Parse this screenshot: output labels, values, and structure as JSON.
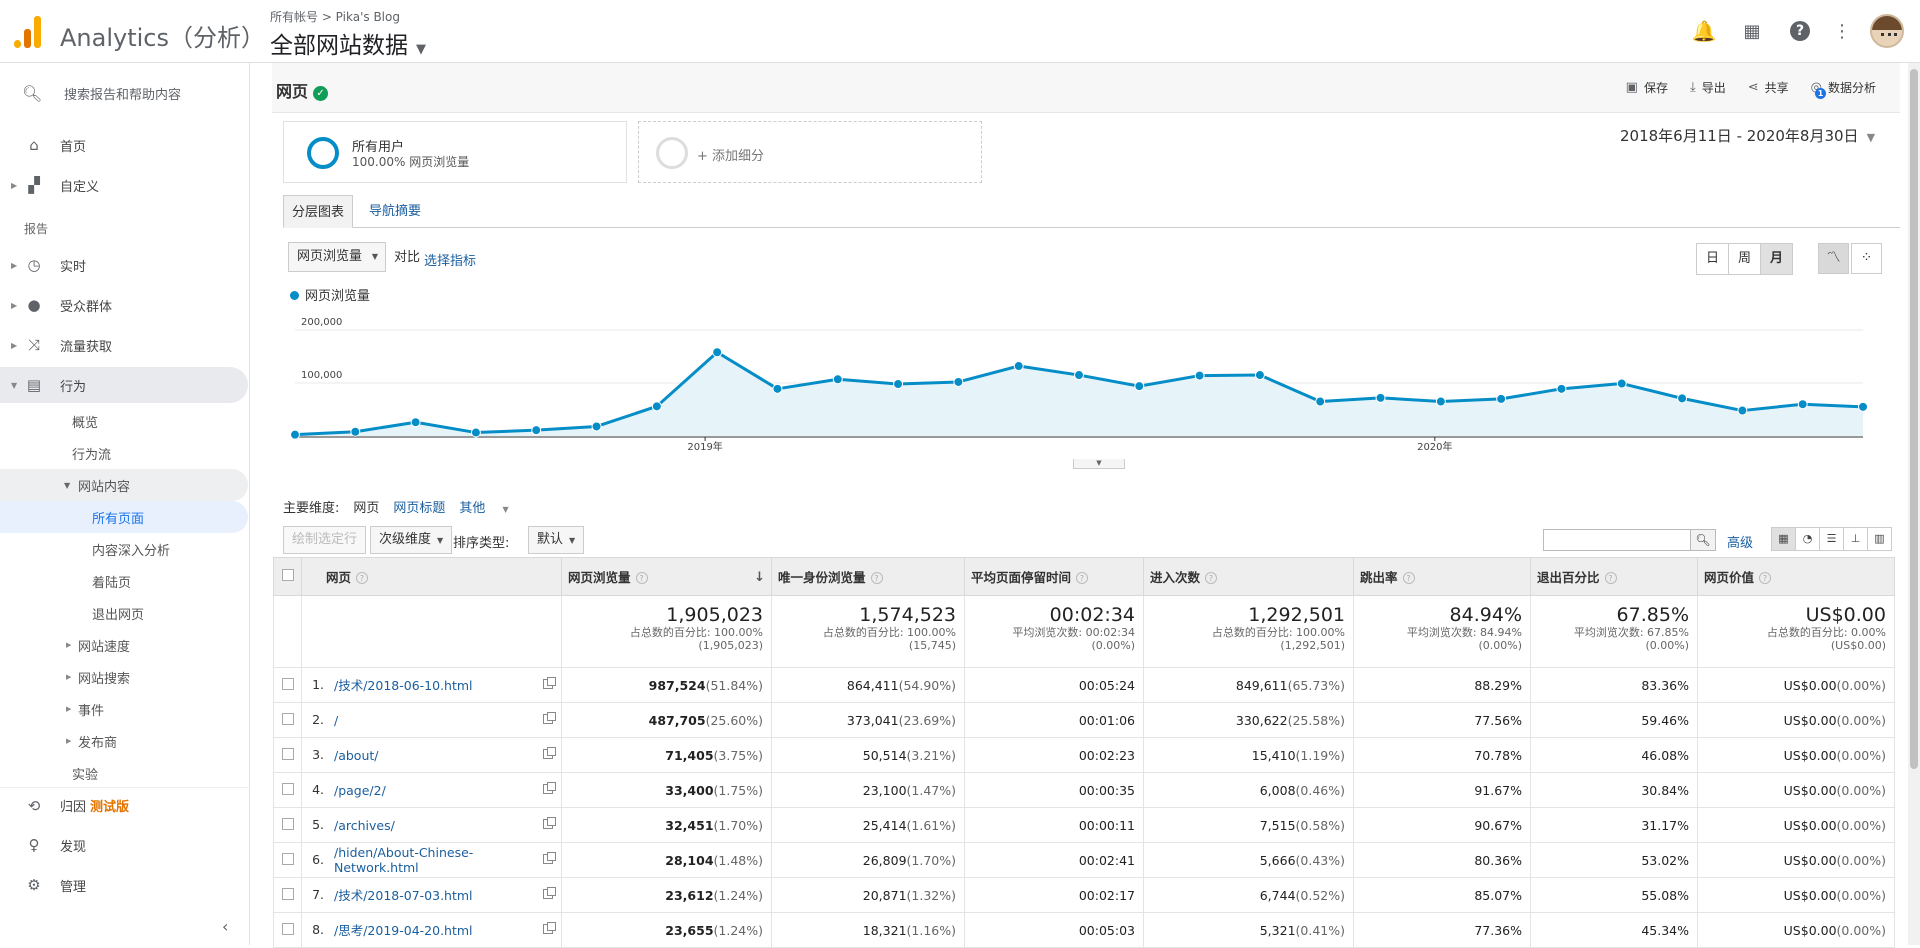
{
  "app": {
    "title": "Analytics（分析）",
    "account_path": "所有帐号 > Pika's Blog",
    "property": "全部网站数据"
  },
  "sidebar": {
    "search_placeholder": "搜索报告和帮助内容",
    "home": "首页",
    "customize": "自定义",
    "reports_heading": "报告",
    "realtime": "实时",
    "audience": "受众群体",
    "acquisition": "流量获取",
    "behavior": "行为",
    "behavior_sub": {
      "overview": "概览",
      "flow": "行为流",
      "site_content": "网站内容",
      "all_pages": "所有页面",
      "drilldown": "内容深入分析",
      "landing": "着陆页",
      "exit": "退出网页",
      "speed": "网站速度",
      "search": "网站搜索",
      "events": "事件",
      "publisher": "发布商",
      "experiments": "实验"
    },
    "attribution": "归因",
    "attribution_badge": "测试版",
    "discover": "发现",
    "admin": "管理"
  },
  "header": {
    "page_title": "网页",
    "save": "保存",
    "export": "导出",
    "share": "共享",
    "insights": "数据分析",
    "insights_badge": "1"
  },
  "segments": {
    "all_users": "所有用户",
    "all_users_sub": "100.00% 网页浏览量",
    "add_segment": "+ 添加细分"
  },
  "date_range": "2018年6月11日 - 2020年8月30日",
  "tabs": {
    "explorer": "分层图表",
    "nav_summary": "导航摘要"
  },
  "chart_controls": {
    "metric": "网页浏览量",
    "vs": "对比",
    "pick_metric": "选择指标",
    "day": "日",
    "week": "周",
    "month": "月"
  },
  "chart_data": {
    "type": "area",
    "series": [
      {
        "name": "网页浏览量",
        "color": "#058dc7",
        "values": [
          2500,
          8000,
          26000,
          6500,
          11000,
          18000,
          56000,
          158000,
          89000,
          107000,
          98000,
          102000,
          132000,
          115000,
          94000,
          114000,
          115000,
          65000,
          72000,
          65000,
          70000,
          89000,
          99000,
          71000,
          48000,
          60000,
          55000
        ]
      }
    ],
    "x_tick_labels": [
      "2019年",
      "2020年"
    ],
    "y_tick_labels": [
      "200,000",
      "100,000"
    ],
    "ylim": [
      0,
      200000
    ],
    "grid": true
  },
  "dimensions": {
    "label": "主要维度:",
    "current": "网页",
    "page_title": "网页标题",
    "other": "其他"
  },
  "toolbar": {
    "plot_rows": "绘制选定行",
    "secondary": "次级维度",
    "sort_label": "排序类型:",
    "sort_value": "默认",
    "advanced": "高级"
  },
  "table": {
    "headers": [
      "网页",
      "网页浏览量",
      "唯一身份浏览量",
      "平均页面停留时间",
      "进入次数",
      "跳出率",
      "退出百分比",
      "网页价值"
    ],
    "totals": [
      {
        "big": "1,905,023",
        "sub1": "占总数的百分比: 100.00%",
        "sub2": "(1,905,023)"
      },
      {
        "big": "1,574,523",
        "sub1": "占总数的百分比: 100.00%",
        "sub2": "(15,745)"
      },
      {
        "big": "00:02:34",
        "sub1": "平均浏览次数: 00:02:34",
        "sub2": "(0.00%)"
      },
      {
        "big": "1,292,501",
        "sub1": "占总数的百分比: 100.00%",
        "sub2": "(1,292,501)"
      },
      {
        "big": "84.94%",
        "sub1": "平均浏览次数: 84.94%",
        "sub2": "(0.00%)"
      },
      {
        "big": "67.85%",
        "sub1": "平均浏览次数: 67.85%",
        "sub2": "(0.00%)"
      },
      {
        "big": "US$0.00",
        "sub1": "占总数的百分比: 0.00%",
        "sub2": "(US$0.00)"
      }
    ],
    "rows": [
      {
        "n": "1.",
        "page": "/技术/2018-06-10.html",
        "pv": "987,524",
        "pvp": "(51.84%)",
        "upv": "864,411",
        "upvp": "(54.90%)",
        "time": "00:05:24",
        "ent": "849,611",
        "entp": "(65.73%)",
        "bounce": "88.29%",
        "exit": "83.36%",
        "val": "US$0.00",
        "valp": "(0.00%)"
      },
      {
        "n": "2.",
        "page": "/",
        "pv": "487,705",
        "pvp": "(25.60%)",
        "upv": "373,041",
        "upvp": "(23.69%)",
        "time": "00:01:06",
        "ent": "330,622",
        "entp": "(25.58%)",
        "bounce": "77.56%",
        "exit": "59.46%",
        "val": "US$0.00",
        "valp": "(0.00%)"
      },
      {
        "n": "3.",
        "page": "/about/",
        "pv": "71,405",
        "pvp": "(3.75%)",
        "upv": "50,514",
        "upvp": "(3.21%)",
        "time": "00:02:23",
        "ent": "15,410",
        "entp": "(1.19%)",
        "bounce": "70.78%",
        "exit": "46.08%",
        "val": "US$0.00",
        "valp": "(0.00%)"
      },
      {
        "n": "4.",
        "page": "/page/2/",
        "pv": "33,400",
        "pvp": "(1.75%)",
        "upv": "23,100",
        "upvp": "(1.47%)",
        "time": "00:00:35",
        "ent": "6,008",
        "entp": "(0.46%)",
        "bounce": "91.67%",
        "exit": "30.84%",
        "val": "US$0.00",
        "valp": "(0.00%)"
      },
      {
        "n": "5.",
        "page": "/archives/",
        "pv": "32,451",
        "pvp": "(1.70%)",
        "upv": "25,414",
        "upvp": "(1.61%)",
        "time": "00:00:11",
        "ent": "7,515",
        "entp": "(0.58%)",
        "bounce": "90.67%",
        "exit": "31.17%",
        "val": "US$0.00",
        "valp": "(0.00%)"
      },
      {
        "n": "6.",
        "page": "/hiden/About-Chinese-Network.html",
        "pv": "28,104",
        "pvp": "(1.48%)",
        "upv": "26,809",
        "upvp": "(1.70%)",
        "time": "00:02:41",
        "ent": "5,666",
        "entp": "(0.43%)",
        "bounce": "80.36%",
        "exit": "53.02%",
        "val": "US$0.00",
        "valp": "(0.00%)"
      },
      {
        "n": "7.",
        "page": "/技术/2018-07-03.html",
        "pv": "23,612",
        "pvp": "(1.24%)",
        "upv": "20,871",
        "upvp": "(1.32%)",
        "time": "00:02:17",
        "ent": "6,744",
        "entp": "(0.52%)",
        "bounce": "85.07%",
        "exit": "55.08%",
        "val": "US$0.00",
        "valp": "(0.00%)"
      },
      {
        "n": "8.",
        "page": "/思考/2019-04-20.html",
        "pv": "23,655",
        "pvp": "(1.24%)",
        "upv": "18,321",
        "upvp": "(1.16%)",
        "time": "00:05:03",
        "ent": "5,321",
        "entp": "(0.41%)",
        "bounce": "77.36%",
        "exit": "45.34%",
        "val": "US$0.00",
        "valp": "(0.00%)"
      }
    ]
  }
}
